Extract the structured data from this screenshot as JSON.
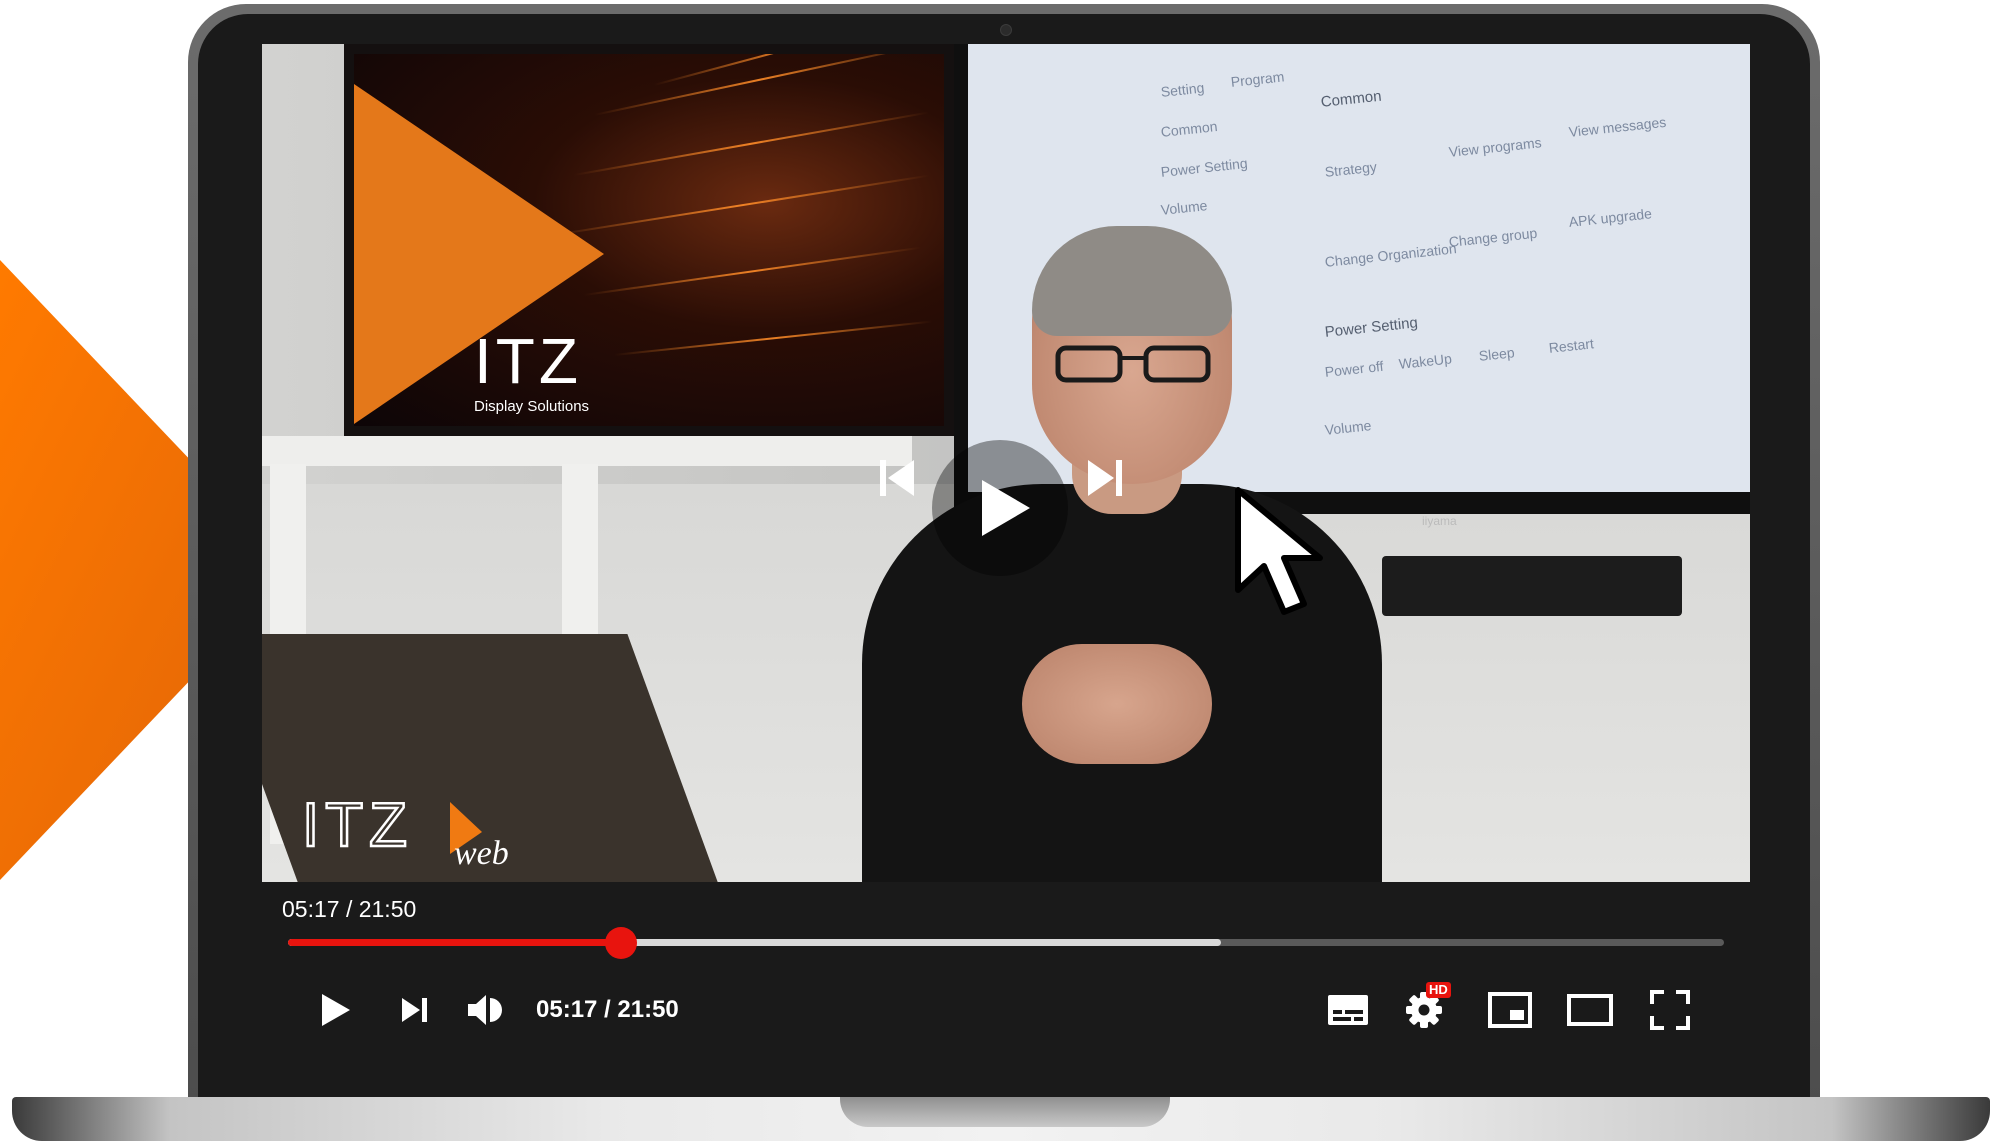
{
  "watermark": {
    "brand": "ITZ",
    "sub": "web"
  },
  "tv_logo": {
    "text": "ITZ",
    "subtitle": "Display Solutions"
  },
  "tv_screen": {
    "tabs": [
      "Setting",
      "Program"
    ],
    "sidebar": [
      "Common",
      "Power Setting",
      "Volume"
    ],
    "section_common": "Common",
    "items": [
      "Strategy",
      "View programs",
      "View messages",
      "Change Organization",
      "Change group",
      "APK upgrade"
    ],
    "section_power": "Power Setting",
    "power_options": [
      "Power off",
      "WakeUp",
      "Sleep",
      "Restart"
    ],
    "section_volume": "Volume",
    "monitor_brand": "iiyama"
  },
  "player": {
    "current_time": "05:17",
    "duration": "21:50",
    "time_display_top": "05:17 / 21:50",
    "time_display_bottom": "05:17 / 21:50",
    "played_fraction": 0.232,
    "buffered_fraction": 0.65,
    "hd_badge": "HD",
    "accent_color": "#e8140e"
  },
  "icons": [
    "previous-icon",
    "play-icon",
    "next-icon",
    "volume-icon",
    "subtitles-icon",
    "settings-icon",
    "miniplayer-icon",
    "theater-icon",
    "fullscreen-icon",
    "mouse-cursor-icon"
  ]
}
